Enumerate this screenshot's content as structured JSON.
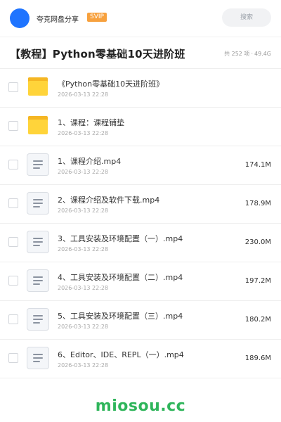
{
  "header": {
    "site_name": "夸克网盘分享",
    "svip_badge": "SVIP",
    "search_placeholder": "搜索"
  },
  "folder": {
    "title": "【教程】Python零基础10天进阶班",
    "item_count": "共 252 项",
    "separator": "·",
    "total_size": "49.4G"
  },
  "items": [
    {
      "type": "folder",
      "name": "《Python零基础10天进阶班》",
      "date": "2026-03-13 22:28",
      "size": ""
    },
    {
      "type": "folder",
      "name": "1、课程：课程铺垫",
      "date": "2026-03-13 22:28",
      "size": ""
    },
    {
      "type": "file",
      "name": "1、课程介绍.mp4",
      "date": "2026-03-13 22:28",
      "size": "174.1M"
    },
    {
      "type": "file",
      "name": "2、课程介绍及软件下载.mp4",
      "date": "2026-03-13 22:28",
      "size": "178.9M"
    },
    {
      "type": "file",
      "name": "3、工具安装及环境配置（一）.mp4",
      "date": "2026-03-13 22:28",
      "size": "230.0M"
    },
    {
      "type": "file",
      "name": "4、工具安装及环境配置（二）.mp4",
      "date": "2026-03-13 22:28",
      "size": "197.2M"
    },
    {
      "type": "file",
      "name": "5、工具安装及环境配置（三）.mp4",
      "date": "2026-03-13 22:28",
      "size": "180.2M"
    },
    {
      "type": "file",
      "name": "6、Editor、IDE、REPL（一）.mp4",
      "date": "2026-03-13 22:28",
      "size": "189.6M"
    }
  ],
  "watermark": "miosou.cc",
  "colors": {
    "avatar": "#1f74ff",
    "svip": "#f7a13e",
    "folder": "#ffd43a",
    "watermark": "#2fb55b"
  }
}
